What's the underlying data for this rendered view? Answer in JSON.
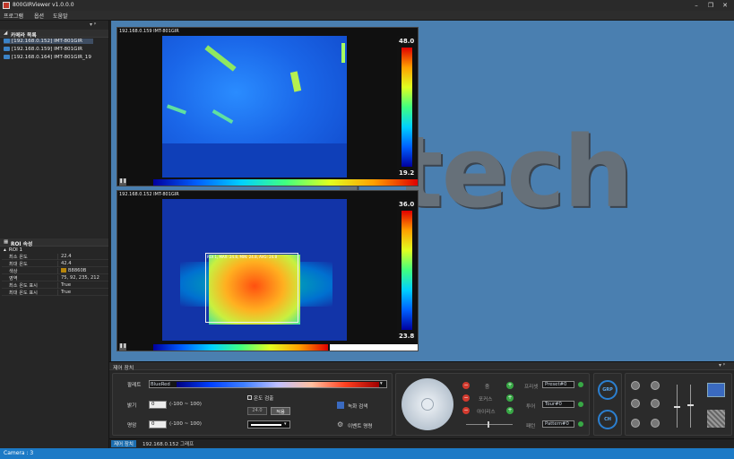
{
  "window": {
    "title": "800GIRViewer v1.0.0.0"
  },
  "menu": {
    "items": [
      "프로그램",
      "옵션",
      "도움말"
    ]
  },
  "camera_list": {
    "header": "카메라 목록",
    "items": [
      {
        "label": "[192.168.0.152] IMT-801GIR",
        "selected": true
      },
      {
        "label": "[192.168.0.159] IMT-801GIR",
        "selected": false
      },
      {
        "label": "[192.168.0.164] IMT-801GIR_19",
        "selected": false
      }
    ]
  },
  "roi_props": {
    "header": "ROI 속성",
    "section": "ROI 1",
    "rows": [
      {
        "name": "최소 온도",
        "value": "22.4"
      },
      {
        "name": "최대 온도",
        "value": "42.4"
      },
      {
        "name": "색상",
        "value": "B8860B"
      },
      {
        "name": "영역",
        "value": "75, 92, 235, 212"
      },
      {
        "name": "최소 온도 표시",
        "value": "True"
      },
      {
        "name": "최대 온도 표시",
        "value": "True"
      }
    ]
  },
  "background_brand": "i tech",
  "views": [
    {
      "label": "192.168.0.159 IMT-801GIR",
      "max": "48.0",
      "min": "19.2"
    },
    {
      "label": "192.168.0.152 IMT-801GIR",
      "max": "36.0",
      "min": "23.8",
      "roi_label": "ROI 1, MAX: 24.8, MIN: 24.8, AVG: 24.8"
    }
  ],
  "control": {
    "header": "제어 장치",
    "palette_label": "팔레트",
    "palette_value": "BlueRed",
    "temp_detect_label": "온도 검출",
    "brightness_label": "밝기",
    "brightness_value": "0",
    "brightness_range": "(-100 ~ 100)",
    "contrast_label": "명암",
    "contrast_value": "0",
    "contrast_range": "(-100 ~ 100)",
    "temp_value_placeholder": "24.0",
    "apply_label": "적용",
    "record_search_label": "녹화 검색",
    "event_log_label": "이벤트 명령",
    "ptz": {
      "zoom_label": "줌",
      "focus_label": "포커스",
      "iris_label": "아이리스",
      "preset_label": "프리셋",
      "tour_label": "투어",
      "pattern_label": "패턴",
      "preset_value": "Preset#0",
      "tour_value": "Tour#0",
      "pattern_value": "Pattern#0"
    },
    "grp_label": "GRP",
    "ch_label": "CH"
  },
  "bottom_tabs": [
    "제어 장치",
    "192.168.0.152 그래프"
  ],
  "status": {
    "camera_count": "Camera : 3"
  },
  "colors": {
    "accent": "#1c7ac6",
    "background_blue": "#4a7fb0",
    "roi_color": "#B8860B"
  }
}
